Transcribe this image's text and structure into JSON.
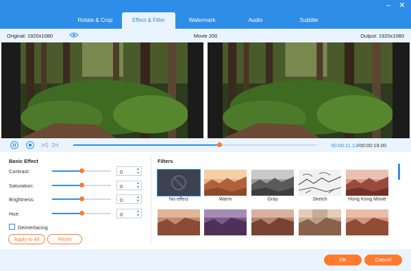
{
  "window": {
    "minimize_glyph": "–",
    "close_glyph": "✕"
  },
  "tabs": [
    {
      "label": "Rotate & Crop"
    },
    {
      "label": "Effect & Filter"
    },
    {
      "label": "Watermark"
    },
    {
      "label": "Audio"
    },
    {
      "label": "Subtitle"
    }
  ],
  "active_tab": "Effect & Filter",
  "info": {
    "original": "Original: 1920x1080",
    "title": "Movie 200",
    "output": "Output: 1920x1080"
  },
  "player": {
    "current_time": "00:00:11.13",
    "total_time": "/00:00:19.00",
    "progress": 0.6
  },
  "basic_effect": {
    "title": "Basic Effect",
    "rows": [
      {
        "label": "Contrast:",
        "value": "0",
        "level": 0.5
      },
      {
        "label": "Saturation:",
        "value": "0",
        "level": 0.5
      },
      {
        "label": "Brightness:",
        "value": "0",
        "level": 0.5
      },
      {
        "label": "Hue:",
        "value": "0",
        "level": 0.5
      }
    ],
    "deinterlacing_label": "Deinterlacing",
    "deinterlacing_checked": false,
    "apply_all_label": "Apply to All",
    "reset_label": "Reset"
  },
  "filters": {
    "title": "Filters",
    "items": [
      {
        "label": "No effect"
      },
      {
        "label": "Warm"
      },
      {
        "label": "Gray"
      },
      {
        "label": "Sketch"
      },
      {
        "label": "Hong Kong Movie"
      }
    ]
  },
  "footer": {
    "ok_label": "OK",
    "cancel_label": "Cancel"
  },
  "colors": {
    "accent_blue": "#2e8de6",
    "accent_orange": "#ff7a2f"
  }
}
